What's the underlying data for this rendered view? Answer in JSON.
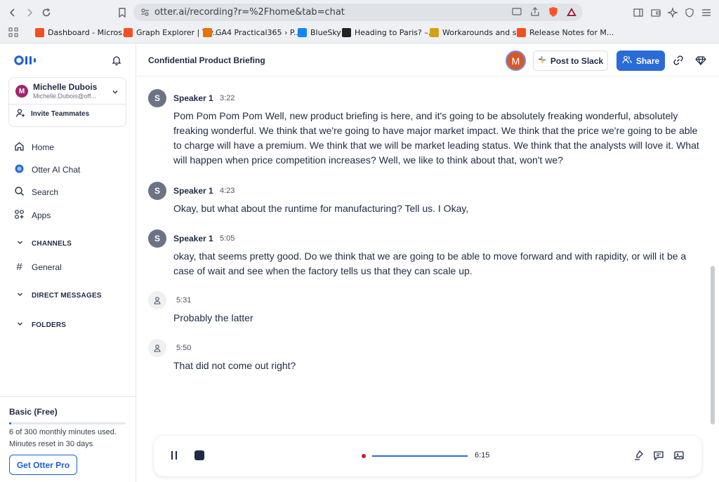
{
  "browser": {
    "url": "otter.ai/recording?r=%2Fhome&tab=chat",
    "bookmarks": [
      {
        "label": "Dashboard - Micros...",
        "color": "#f25022"
      },
      {
        "label": "Graph Explorer | Try...",
        "color": "#f25022"
      },
      {
        "label": "GA4 Practical365 › P...",
        "color": "#e37400"
      },
      {
        "label": "BlueSky",
        "color": "#1185fe"
      },
      {
        "label": "Heading to Paris? –...",
        "color": "#222222"
      },
      {
        "label": "Workarounds and s...",
        "color": "#d4a017"
      },
      {
        "label": "Release Notes for M...",
        "color": "#f25022"
      }
    ]
  },
  "sidebar": {
    "user_initial": "M",
    "user_name": "Michelle Dubois",
    "user_email": "Michelle.Dubois@off...",
    "invite_label": "Invite Teammates",
    "nav": [
      {
        "label": "Home",
        "icon": "home-icon"
      },
      {
        "label": "Otter AI Chat",
        "icon": "otter-chat-icon"
      },
      {
        "label": "Search",
        "icon": "search-icon"
      },
      {
        "label": "Apps",
        "icon": "apps-icon"
      }
    ],
    "channels_label": "CHANNELS",
    "general_label": "General",
    "dm_label": "DIRECT MESSAGES",
    "folders_label": "FOLDERS",
    "plan_title": "Basic (Free)",
    "plan_used": "6 of 300 monthly minutes used.",
    "plan_reset": "Minutes reset in 30 days",
    "plan_fraction": 0.02,
    "get_pro_label": "Get Otter Pro"
  },
  "header": {
    "title": "Confidential Product Briefing",
    "avatar_initial": "M",
    "slack_label": "Post to Slack",
    "share_label": "Share"
  },
  "transcript": [
    {
      "speaker": "Speaker 1",
      "initial": "S",
      "time": "3:22",
      "text": "Pom Pom Pom Pom Well, new product briefing is here, and it's going to be absolutely freaking wonderful, absolutely freaking wonderful. We think that we're going to have major market impact. We think that the price we're going to be able to charge will have a premium. We think that we will be market leading status. We think that the analysts will love it. What will happen when price competition increases? Well, we like to think about that, won't we?"
    },
    {
      "speaker": "Speaker 1",
      "initial": "S",
      "time": "4:23",
      "text": "Okay, but what about the runtime for manufacturing? Tell us. I Okay,"
    },
    {
      "speaker": "Speaker 1",
      "initial": "S",
      "time": "5:05",
      "text": "okay, that seems pretty good. Do we think that we are going to be able to move forward and with rapidity, or will it be  a case of wait and see when the factory tells us that they can scale up."
    },
    {
      "speaker": "",
      "initial": "",
      "time": "5:31",
      "text": "Probably the latter"
    },
    {
      "speaker": "",
      "initial": "",
      "time": "5:50",
      "text": "That did not come out right?"
    }
  ],
  "player": {
    "elapsed": "6:15"
  }
}
